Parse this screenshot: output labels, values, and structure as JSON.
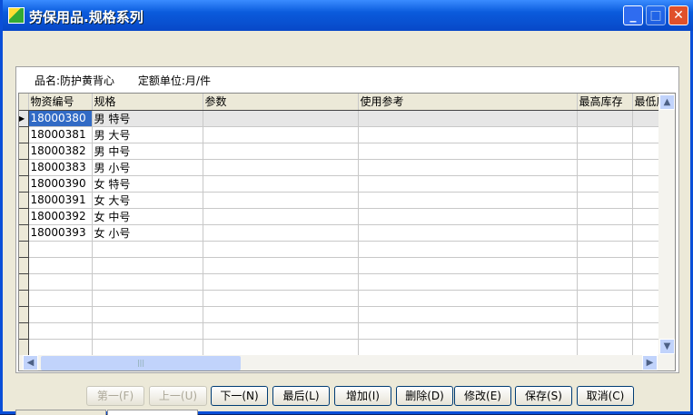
{
  "window": {
    "title": "劳保用品.规格系列"
  },
  "info": {
    "name_label": "品名:防护黄背心",
    "unit_label": "定额单位:月/件"
  },
  "grid": {
    "columns": [
      "物资编号",
      "规格",
      "参数",
      "使用参考",
      "最高库存",
      "最低库"
    ],
    "rows": [
      {
        "code": "18000380",
        "spec": "男 特号"
      },
      {
        "code": "18000381",
        "spec": "男 大号"
      },
      {
        "code": "18000382",
        "spec": "男 中号"
      },
      {
        "code": "18000383",
        "spec": "男 小号"
      },
      {
        "code": "18000390",
        "spec": "女 特号"
      },
      {
        "code": "18000391",
        "spec": "女 大号"
      },
      {
        "code": "18000392",
        "spec": "女 中号"
      },
      {
        "code": "18000393",
        "spec": "女 小号"
      }
    ],
    "selected_row": 0
  },
  "buttons": [
    {
      "label": "第一(F)",
      "enabled": false
    },
    {
      "label": "上一(U)",
      "enabled": false
    },
    {
      "label": "下一(N)",
      "enabled": true
    },
    {
      "label": "最后(L)",
      "enabled": true
    },
    {
      "label": "增加(I)",
      "enabled": true
    },
    {
      "label": "删除(D)",
      "enabled": true
    },
    {
      "label": "修改(E)",
      "enabled": true
    },
    {
      "label": "保存(S)",
      "enabled": true
    },
    {
      "label": "取消(C)",
      "enabled": true
    }
  ]
}
